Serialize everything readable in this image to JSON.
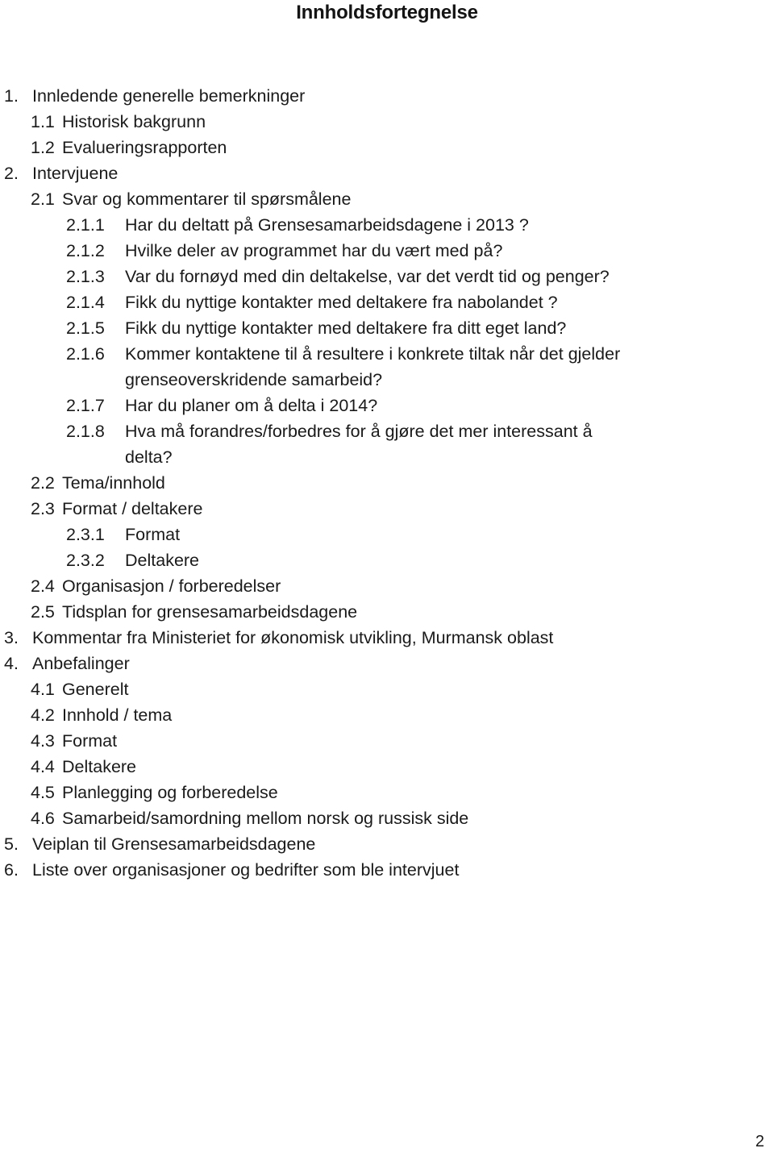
{
  "document": {
    "title": "Innholdsfortegnelse",
    "page_number": "2",
    "text_color": "#1a1a1a",
    "background_color": "#ffffff"
  },
  "toc": {
    "entries": [
      {
        "level": 1,
        "number": "1.",
        "label": "Innledende generelle bemerkninger"
      },
      {
        "level": 2,
        "number": "1.1",
        "label": "Historisk bakgrunn"
      },
      {
        "level": 2,
        "number": "1.2",
        "label": "Evalueringsrapporten"
      },
      {
        "level": 1,
        "number": "2.",
        "label": "Intervjuene"
      },
      {
        "level": 2,
        "number": "2.1",
        "label": "Svar og kommentarer til spørsmålene"
      },
      {
        "level": 3,
        "number": "2.1.1",
        "label": "Har du deltatt på Grensesamarbeidsdagene i 2013 ?"
      },
      {
        "level": 3,
        "number": "2.1.2",
        "label": "Hvilke deler av programmet har du vært med på?"
      },
      {
        "level": 3,
        "number": "2.1.3",
        "label": "Var du fornøyd med din deltakelse, var det verdt tid og penger?"
      },
      {
        "level": 3,
        "number": "2.1.4",
        "label": "Fikk du nyttige kontakter med deltakere fra nabolandet ?"
      },
      {
        "level": 3,
        "number": "2.1.5",
        "label": "Fikk du nyttige kontakter med deltakere fra ditt eget land?"
      },
      {
        "level": 3,
        "number": "2.1.6",
        "label": "Kommer kontaktene til å resultere i konkrete tiltak når det gjelder grenseoverskridende samarbeid?"
      },
      {
        "level": 3,
        "number": "2.1.7",
        "label": "Har du planer om å delta i 2014?"
      },
      {
        "level": 3,
        "number": "2.1.8",
        "label": "Hva må forandres/forbedres for å gjøre det mer interessant å delta?"
      },
      {
        "level": 2,
        "number": "2.2",
        "label": "Tema/innhold"
      },
      {
        "level": 2,
        "number": "2.3",
        "label": "Format  / deltakere"
      },
      {
        "level": 3,
        "number": "2.3.1",
        "label": "Format"
      },
      {
        "level": 3,
        "number": "2.3.2",
        "label": "Deltakere"
      },
      {
        "level": 2,
        "number": "2.4",
        "label": "Organisasjon / forberedelser"
      },
      {
        "level": 2,
        "number": "2.5",
        "label": "Tidsplan for grensesamarbeidsdagene"
      },
      {
        "level": 1,
        "number": "3.",
        "label": "Kommentar fra Ministeriet for økonomisk utvikling, Murmansk oblast"
      },
      {
        "level": 1,
        "number": "4.",
        "label": "Anbefalinger"
      },
      {
        "level": 2,
        "number": "4.1",
        "label": "Generelt"
      },
      {
        "level": 2,
        "number": "4.2",
        "label": "Innhold / tema"
      },
      {
        "level": 2,
        "number": "4.3",
        "label": "Format"
      },
      {
        "level": 2,
        "number": "4.4",
        "label": "Deltakere"
      },
      {
        "level": 2,
        "number": "4.5",
        "label": "Planlegging og forberedelse"
      },
      {
        "level": 2,
        "number": "4.6",
        "label": "Samarbeid/samordning mellom norsk og russisk side"
      },
      {
        "level": 1,
        "number": "5.",
        "label": "Veiplan til Grensesamarbeidsdagene"
      },
      {
        "level": 1,
        "number": "6.",
        "label": "Liste over organisasjoner og bedrifter som ble intervjuet"
      }
    ]
  }
}
